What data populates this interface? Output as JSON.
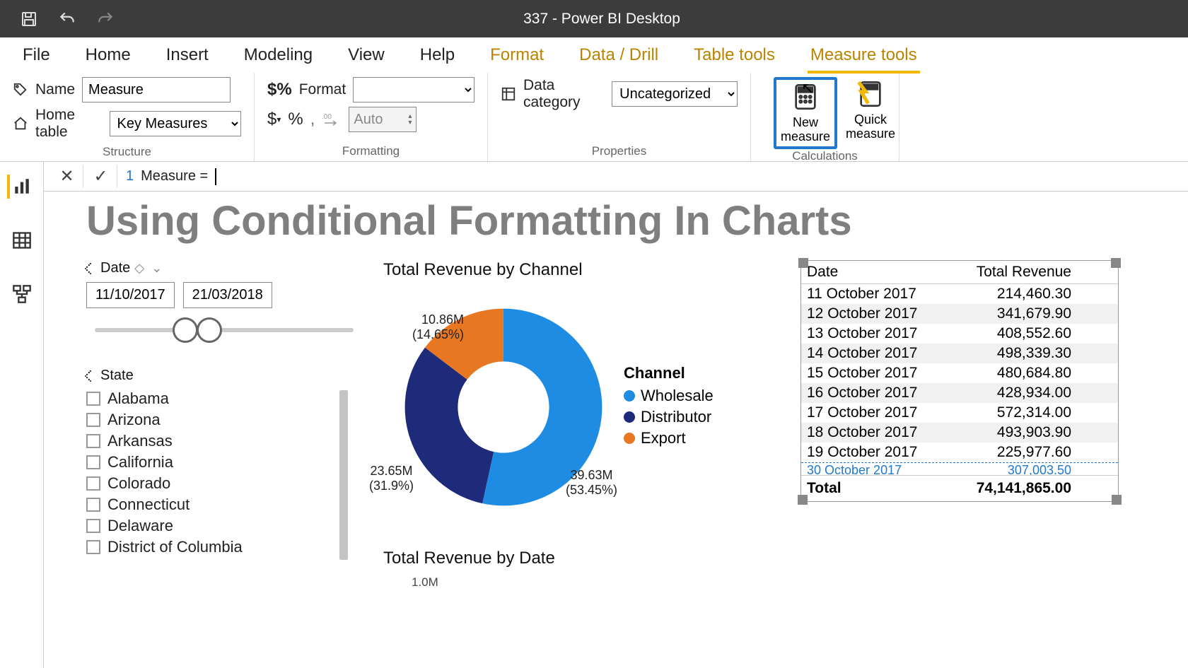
{
  "titlebar": {
    "title": "337 - Power BI Desktop"
  },
  "tabs": {
    "file": "File",
    "items": [
      "Home",
      "Insert",
      "Modeling",
      "View",
      "Help"
    ],
    "context": [
      "Format",
      "Data / Drill",
      "Table tools",
      "Measure tools"
    ],
    "active": "Measure tools"
  },
  "ribbon": {
    "structure": {
      "name_label": "Name",
      "name_value": "Measure",
      "home_table_label": "Home table",
      "home_table_value": "Key Measures",
      "group_label": "Structure"
    },
    "formatting": {
      "format_label": "Format",
      "format_value": "",
      "auto_placeholder": "Auto",
      "group_label": "Formatting"
    },
    "properties": {
      "data_category_label": "Data category",
      "data_category_value": "Uncategorized",
      "group_label": "Properties"
    },
    "calculations": {
      "new_measure": "New measure",
      "quick_measure": "Quick measure",
      "group_label": "Calculations"
    }
  },
  "formula": {
    "line_no": "1",
    "text": "Measure = "
  },
  "report": {
    "title": "Using Conditional Formatting In Charts",
    "date_slicer": {
      "label": "Date",
      "from": "11/10/2017",
      "to": "21/03/2018"
    },
    "state_slicer": {
      "label": "State",
      "items": [
        "Alabama",
        "Arizona",
        "Arkansas",
        "California",
        "Colorado",
        "Connecticut",
        "Delaware",
        "District of Columbia"
      ]
    },
    "donut": {
      "title": "Total Revenue by Channel",
      "legend_title": "Channel",
      "legend": [
        {
          "name": "Wholesale",
          "color": "#1f8ce4"
        },
        {
          "name": "Distributor",
          "color": "#1e2a7a"
        },
        {
          "name": "Export",
          "color": "#e87722"
        }
      ],
      "labels": {
        "export_val": "10.86M",
        "export_pct": "(14.65%)",
        "distributor_val": "23.65M",
        "distributor_pct": "(31.9%)",
        "wholesale_val": "39.63M",
        "wholesale_pct": "(53.45%)"
      }
    },
    "line_chart_title": "Total Revenue by Date",
    "line_chart_ytick": "1.0M",
    "table": {
      "cols": [
        "Date",
        "Total Revenue"
      ],
      "rows": [
        {
          "date": "11 October 2017",
          "rev": "214,460.30"
        },
        {
          "date": "12 October 2017",
          "rev": "341,679.90"
        },
        {
          "date": "13 October 2017",
          "rev": "408,552.60"
        },
        {
          "date": "14 October 2017",
          "rev": "498,339.30"
        },
        {
          "date": "15 October 2017",
          "rev": "480,684.80"
        },
        {
          "date": "16 October 2017",
          "rev": "428,934.00"
        },
        {
          "date": "17 October 2017",
          "rev": "572,314.00"
        },
        {
          "date": "18 October 2017",
          "rev": "493,903.90"
        },
        {
          "date": "19 October 2017",
          "rev": "225,977.60"
        }
      ],
      "cut_row": {
        "date": "30 October 2017",
        "rev": "307,003.50"
      },
      "total_label": "Total",
      "total_value": "74,141,865.00"
    }
  },
  "chart_data": {
    "type": "pie",
    "title": "Total Revenue by Channel",
    "series": [
      {
        "name": "Wholesale",
        "value": 39.63,
        "pct": 53.45,
        "unit": "M"
      },
      {
        "name": "Distributor",
        "value": 23.65,
        "pct": 31.9,
        "unit": "M"
      },
      {
        "name": "Export",
        "value": 10.86,
        "pct": 14.65,
        "unit": "M"
      }
    ]
  }
}
